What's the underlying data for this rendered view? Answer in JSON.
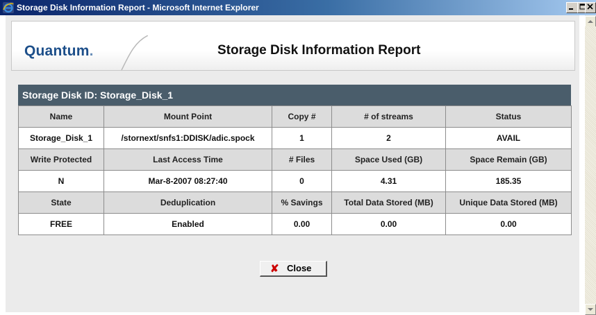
{
  "window": {
    "title": "Storage Disk Information Report - Microsoft Internet Explorer",
    "minimize_icon": "minimize-icon",
    "maximize_icon": "maximize-icon",
    "close_icon": "close-icon"
  },
  "header": {
    "logo": "Quantum",
    "logo_dot": ".",
    "title": "Storage Disk Information Report"
  },
  "disk": {
    "section_title": "Storage Disk ID: Storage_Disk_1",
    "rows": [
      [
        "Name",
        "Mount Point",
        "Copy #",
        "# of streams",
        "Status"
      ],
      [
        "Storage_Disk_1",
        "/stornext/snfs1:DDISK/adic.spock",
        "1",
        "2",
        "AVAIL"
      ],
      [
        "Write Protected",
        "Last Access Time",
        "# Files",
        "Space Used (GB)",
        "Space Remain (GB)"
      ],
      [
        "N",
        "Mar-8-2007 08:27:40",
        "0",
        "4.31",
        "185.35"
      ],
      [
        "State",
        "Deduplication",
        "% Savings",
        "Total Data Stored (MB)",
        "Unique Data Stored (MB)"
      ],
      [
        "FREE",
        "Enabled",
        "0.00",
        "0.00",
        "0.00"
      ]
    ]
  },
  "footer": {
    "close_label": "Close",
    "close_icon": "x-icon"
  },
  "colors": {
    "section_header_bg": "#4a5d6b",
    "logo_blue": "#1d4f8a",
    "close_x_red": "#cc0000"
  }
}
